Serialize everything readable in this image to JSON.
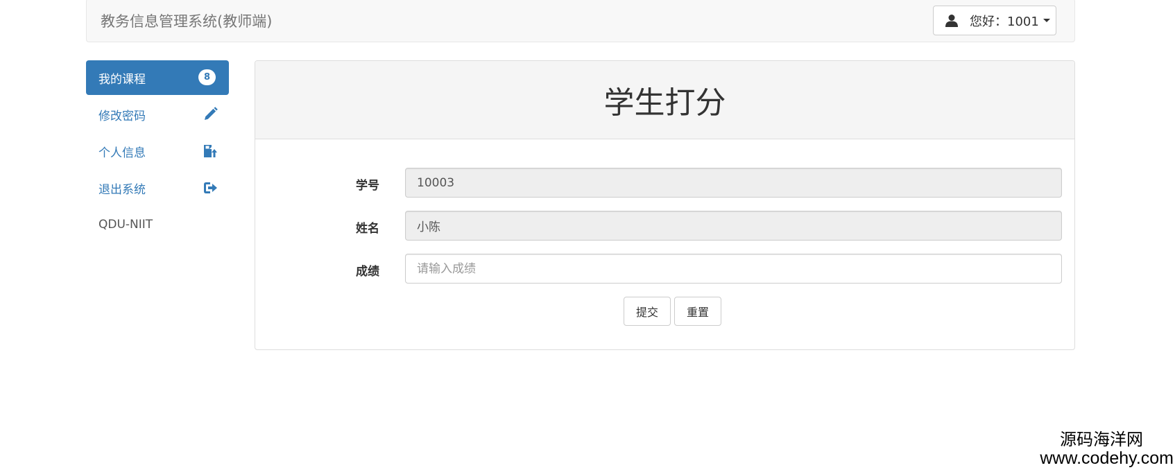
{
  "navbar": {
    "brand": "教务信息管理系统(教师端)",
    "user_label": "您好：1001"
  },
  "sidebar": {
    "items": [
      {
        "label": "我的课程",
        "badge": "8",
        "active": true
      },
      {
        "label": "修改密码",
        "icon": "pencil-icon"
      },
      {
        "label": "个人信息",
        "icon": "save-upload-icon"
      },
      {
        "label": "退出系统",
        "icon": "logout-icon"
      },
      {
        "label": "QDU-NIIT"
      }
    ]
  },
  "panel": {
    "title": "学生打分",
    "fields": {
      "student_id": {
        "label": "学号",
        "value": "10003"
      },
      "name": {
        "label": "姓名",
        "value": "小陈"
      },
      "score": {
        "label": "成绩",
        "placeholder": "请输入成绩"
      }
    },
    "submit_label": "提交",
    "reset_label": "重置"
  },
  "watermark": {
    "line1": "源码海洋网",
    "line2": "www.codehy.com"
  },
  "colors": {
    "primary": "#337ab7",
    "navbar_bg": "#f8f8f8",
    "panel_heading_bg": "#f5f5f5",
    "readonly_bg": "#eeeeee"
  }
}
